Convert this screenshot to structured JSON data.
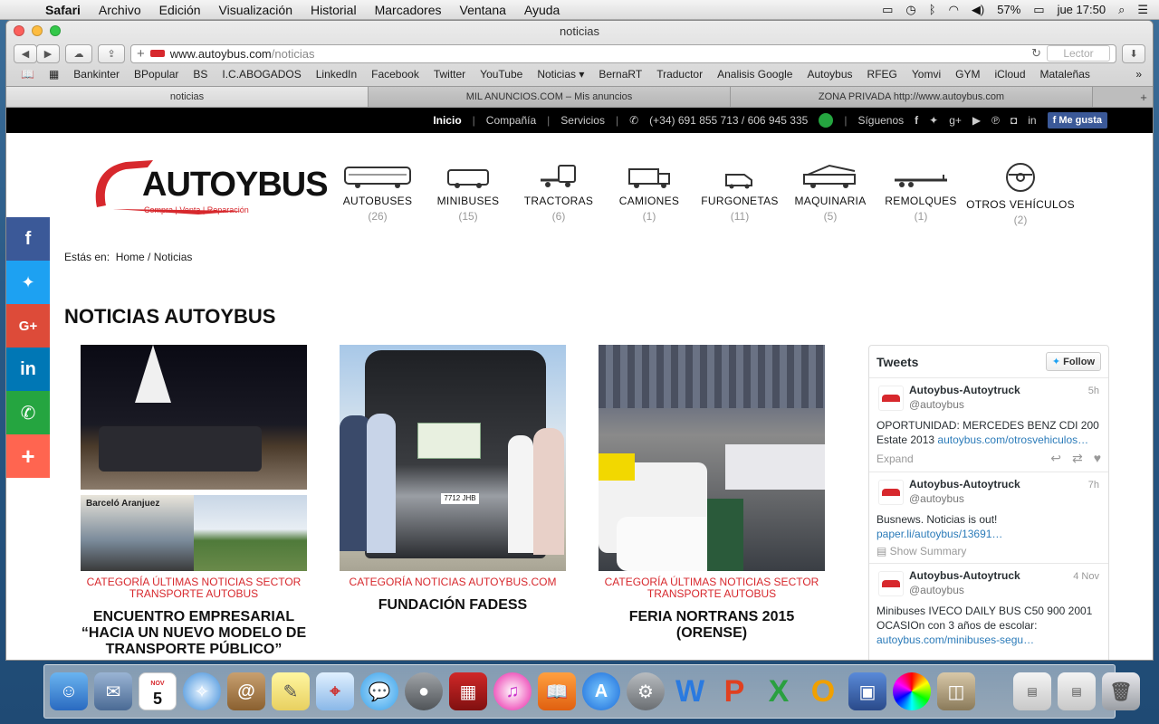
{
  "menubar": {
    "app": "Safari",
    "items": [
      "Archivo",
      "Edición",
      "Visualización",
      "Historial",
      "Marcadores",
      "Ventana",
      "Ayuda"
    ],
    "battery": "57%",
    "clock": "jue 17:50"
  },
  "window": {
    "title": "noticias",
    "url_domain": "www.autoybus.com",
    "url_path": "/noticias",
    "reader_label": "Lector"
  },
  "bookmarks": [
    "Bankinter",
    "BPopular",
    "BS",
    "I.C.ABOGADOS",
    "LinkedIn",
    "Facebook",
    "Twitter",
    "YouTube",
    "Noticias ▾",
    "BernaRT",
    "Traductor",
    "Analisis Google",
    "Autoybus",
    "RFEG",
    "Yomvi",
    "GYM",
    "iCloud",
    "Mataleñas"
  ],
  "tabs": [
    {
      "label": "noticias",
      "active": true
    },
    {
      "label": "MIL ANUNCIOS.COM – Mis anuncios",
      "active": false
    },
    {
      "label": "ZONA PRIVADA http://www.autoybus.com",
      "active": false
    }
  ],
  "topnav": {
    "inicio": "Inicio",
    "compania": "Compañía",
    "servicios": "Servicios",
    "phone": "(+34) 691 855 713 / 606 945 335",
    "siguenos": "Síguenos",
    "megusta": "Me gusta"
  },
  "logo": {
    "word": "AUTOYBUS",
    "tagline": "Compra | Venta | Reparación"
  },
  "categories": [
    {
      "name": "AUTOBUSES",
      "count": "(26)"
    },
    {
      "name": "MINIBUSES",
      "count": "(15)"
    },
    {
      "name": "TRACTORAS",
      "count": "(6)"
    },
    {
      "name": "CAMIONES",
      "count": "(1)"
    },
    {
      "name": "FURGONETAS",
      "count": "(11)"
    },
    {
      "name": "MAQUINARIA",
      "count": "(5)"
    },
    {
      "name": "REMOLQUES",
      "count": "(1)"
    },
    {
      "name": "OTROS VEHÍCULOS",
      "count": "(2)"
    }
  ],
  "breadcrumb": {
    "prefix": "Estás en:",
    "home": "Home",
    "current": "Noticias"
  },
  "page_title": "NOTICIAS AUTOYBUS",
  "articles": [
    {
      "category": "CATEGORÍA ÚLTIMAS NOTICIAS SECTOR TRANSPORTE AUTOBUS",
      "title": "ENCUENTRO EMPRESARIAL “HACIA UN NUEVO MODELO DE TRANSPORTE PÚBLICO”",
      "sign": "Barceló Aranjuez"
    },
    {
      "category": "CATEGORÍA NOTICIAS AUTOYBUS.COM",
      "title": "FUNDACIÓN FADESS",
      "plate": "7712 JHB"
    },
    {
      "category": "CATEGORÍA ÚLTIMAS NOTICIAS SECTOR TRANSPORTE AUTOBUS",
      "title": "FERIA NORTRANS 2015 (ORENSE)"
    }
  ],
  "tweets_widget": {
    "title": "Tweets",
    "follow": "Follow",
    "items": [
      {
        "name": "Autoybus-Autoytruck",
        "handle": "@autoybus",
        "time": "5h",
        "text": "OPORTUNIDAD: MERCEDES BENZ CDI 200 Estate 2013 ",
        "link": "autoybus.com/otrosvehiculos…",
        "action": "Expand"
      },
      {
        "name": "Autoybus-Autoytruck",
        "handle": "@autoybus",
        "time": "7h",
        "text": "Busnews. Noticias  is out!",
        "link": "paper.li/autoybus/13691…",
        "action": "Show Summary"
      },
      {
        "name": "Autoybus-Autoytruck",
        "handle": "@autoybus",
        "time": "4 Nov",
        "text": "Minibuses IVECO DAILY BUS C50 900 2001 OCASIOn con 3 años de escolar:",
        "link": "autoybus.com/minibuses-segu…",
        "action": ""
      }
    ]
  },
  "dock": {
    "calendar_day": "5",
    "calendar_month": "NOV"
  },
  "colors": {
    "brand_red": "#d7282d",
    "facebook": "#3b5998",
    "twitter": "#1da1f2",
    "gplus": "#dd4b39",
    "linkedin": "#0077b5",
    "whatsapp": "#25a540",
    "more": "#ff6550"
  }
}
